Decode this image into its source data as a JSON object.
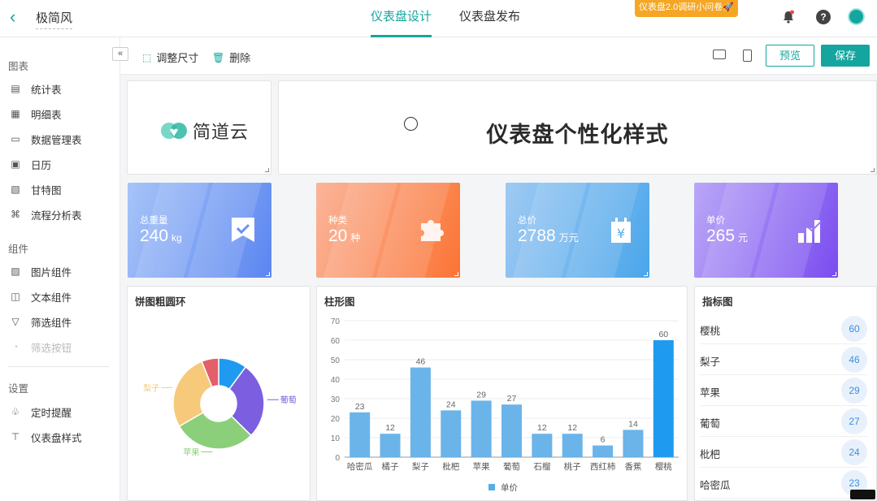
{
  "header": {
    "back_icon": "chevron-left-icon",
    "app_name": "极简风",
    "tabs": [
      {
        "label": "仪表盘设计",
        "active": true
      },
      {
        "label": "仪表盘发布",
        "active": false
      }
    ],
    "survey_label": "仪表盘2.0调研小问卷🚀",
    "help_label": "?"
  },
  "sidebar": {
    "collapse_label": "«",
    "sections": [
      {
        "title": "图表",
        "items": [
          {
            "label": "统计表",
            "icon": "stat-table-icon"
          },
          {
            "label": "明细表",
            "icon": "detail-table-icon"
          },
          {
            "label": "数据管理表",
            "icon": "data-manage-icon"
          },
          {
            "label": "日历",
            "icon": "calendar-icon"
          },
          {
            "label": "甘特图",
            "icon": "gantt-icon"
          },
          {
            "label": "流程分析表",
            "icon": "flow-icon"
          }
        ]
      },
      {
        "title": "组件",
        "items": [
          {
            "label": "图片组件",
            "icon": "image-icon"
          },
          {
            "label": "文本组件",
            "icon": "text-icon"
          },
          {
            "label": "筛选组件",
            "icon": "filter-icon"
          },
          {
            "label": "筛选按钮",
            "icon": "filter-button-icon",
            "disabled": true
          }
        ]
      },
      {
        "title": "设置",
        "items": [
          {
            "label": "定时提醒",
            "icon": "bell-icon"
          },
          {
            "label": "仪表盘样式",
            "icon": "paint-brush-icon"
          }
        ]
      }
    ]
  },
  "toolbar": {
    "resize_label": "调整尺寸",
    "delete_label": "删除",
    "preview_label": "预览",
    "save_label": "保存"
  },
  "dashboard": {
    "logo_text": "简道云",
    "title": "仪表盘个性化样式",
    "kpis": [
      {
        "label": "总重量",
        "value": "240",
        "unit": "kg",
        "icon": "bookmark-check-icon",
        "colors": [
          "#a7c4f8",
          "#5b86f0"
        ]
      },
      {
        "label": "种类",
        "value": "20",
        "unit": "种",
        "icon": "puzzle-icon",
        "colors": [
          "#fbb59a",
          "#fb7434"
        ]
      },
      {
        "label": "总价",
        "value": "2788",
        "unit": "万元",
        "icon": "yen-bag-icon",
        "colors": [
          "#9fcaf3",
          "#4aa6ea"
        ]
      },
      {
        "label": "单价",
        "value": "265",
        "unit": "元",
        "icon": "bar-chart-icon",
        "colors": [
          "#b9a7f7",
          "#7a4cf0"
        ]
      }
    ],
    "pie_title": "饼图粗圆环",
    "bar_title": "柱形图",
    "indicator_title": "指标图",
    "indicators": [
      {
        "name": "樱桃",
        "value": "60"
      },
      {
        "name": "梨子",
        "value": "46"
      },
      {
        "name": "苹果",
        "value": "29"
      },
      {
        "name": "葡萄",
        "value": "27"
      },
      {
        "name": "枇杷",
        "value": "24"
      },
      {
        "name": "哈密瓜",
        "value": "23"
      }
    ]
  },
  "chart_data": [
    {
      "type": "pie",
      "title": "饼图粗圆环",
      "slices": [
        {
          "label": "",
          "value": 10,
          "color": "#1e9bf0"
        },
        {
          "label": "葡萄",
          "value": 27,
          "color": "#7b5fe0"
        },
        {
          "label": "苹果",
          "value": 29,
          "color": "#8ccf7a"
        },
        {
          "label": "梨子",
          "value": 27,
          "color": "#f7c97a"
        },
        {
          "label": "",
          "value": 6,
          "color": "#e45e6b"
        }
      ]
    },
    {
      "type": "bar",
      "title": "柱形图",
      "categories": [
        "哈密瓜",
        "橘子",
        "梨子",
        "枇杷",
        "苹果",
        "葡萄",
        "石榴",
        "桃子",
        "西红柿",
        "香蕉",
        "樱桃"
      ],
      "series": [
        {
          "name": "单价",
          "values": [
            23,
            12,
            46,
            24,
            29,
            27,
            12,
            12,
            6,
            14,
            60
          ]
        }
      ],
      "ylim": [
        0,
        70
      ],
      "yticks": [
        0,
        10,
        20,
        30,
        40,
        50,
        60,
        70
      ],
      "color": "#5aace8",
      "legend": "bottom"
    }
  ]
}
